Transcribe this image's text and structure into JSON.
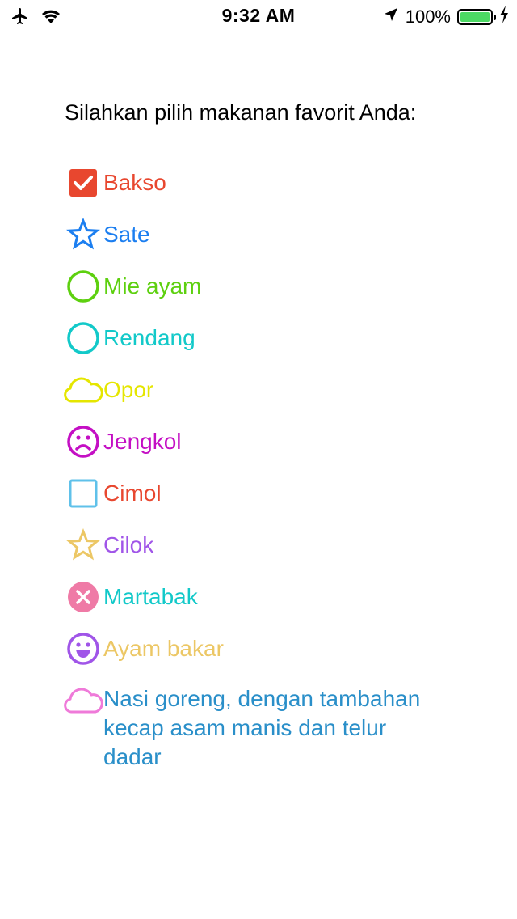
{
  "status_bar": {
    "time": "9:32 AM",
    "battery_percent": "100%",
    "battery_level": 1.0
  },
  "prompt": "Silahkan pilih  makanan favorit Anda:",
  "options": [
    {
      "label": "Bakso",
      "icon": "checkbox-checked-icon",
      "color": "#e8472f",
      "icon_color": "#e8472f"
    },
    {
      "label": "Sate",
      "icon": "star-icon",
      "color": "#1b7ef0",
      "icon_color": "#1b7ef0"
    },
    {
      "label": "Mie ayam",
      "icon": "circle-icon",
      "color": "#5dd00f",
      "icon_color": "#5dd00f"
    },
    {
      "label": "Rendang",
      "icon": "circle-icon",
      "color": "#12c9c9",
      "icon_color": "#12c9c9"
    },
    {
      "label": "Opor",
      "icon": "cloud-icon",
      "color": "#e5e600",
      "icon_color": "#e5e600"
    },
    {
      "label": "Jengkol",
      "icon": "sad-face-icon",
      "color": "#c40fc4",
      "icon_color": "#c40fc4"
    },
    {
      "label": "Cimol",
      "icon": "square-icon",
      "color": "#e8472f",
      "icon_color": "#5fc1ea"
    },
    {
      "label": "Cilok",
      "icon": "star-icon",
      "color": "#a055e8",
      "icon_color": "#ecc765"
    },
    {
      "label": "Martabak",
      "icon": "cross-circle-icon",
      "color": "#12c9c9",
      "icon_color": "#ef7aa6"
    },
    {
      "label": "Ayam bakar",
      "icon": "smile-face-icon",
      "color": "#ecc765",
      "icon_color": "#a055e8"
    },
    {
      "label": "Nasi goreng, dengan tambahan\nkecap asam manis dan telur\ndadar",
      "icon": "cloud-icon",
      "color": "#2a8fc9",
      "icon_color": "#ef7ad9"
    }
  ]
}
